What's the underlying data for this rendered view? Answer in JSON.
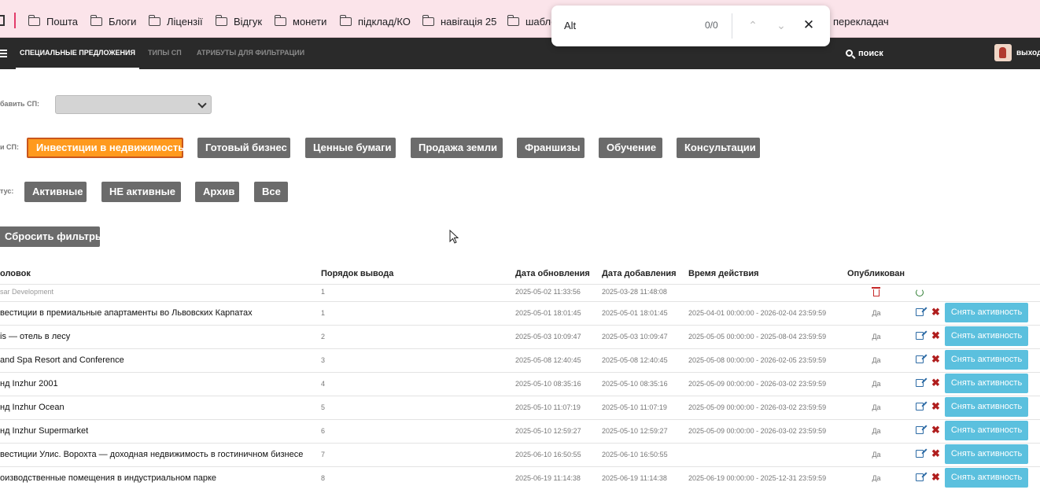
{
  "bookmarks": [
    "Пошта",
    "Блоги",
    "Ліцензії",
    "Відгук",
    "монети",
    "підклад/КО",
    "навігація 25",
    "шабло",
    "перекладач"
  ],
  "find": {
    "query": "Alt",
    "count": "0/0"
  },
  "nav": {
    "tabs": [
      "СПЕЦИАЛЬНЫЕ ПРЕДЛОЖЕНИЯ",
      "ТИПЫ СП",
      "АТРИБУТЫ ДЛЯ ФИЛЬТРАЦИИ"
    ],
    "search": "поиск",
    "exit": "выход"
  },
  "filters": {
    "add_label": "бавить СП:",
    "type_label": "и СП:",
    "status_label": "тус:",
    "types": [
      "Инвестиции в недвижимость",
      "Готовый бизнес",
      "Ценные бумаги",
      "Продажа земли",
      "Франшизы",
      "Обучение",
      "Консультации"
    ],
    "statuses": [
      "Активные",
      "НЕ активные",
      "Архив",
      "Все"
    ],
    "reset": "Сбросить фильтры"
  },
  "table": {
    "headers": [
      "оловок",
      "Порядок вывода",
      "Дата обновления",
      "Дата добавления",
      "Время действия",
      "Опубликован"
    ],
    "rows": [
      {
        "title": "sar Development",
        "order": "1",
        "updated": "2025-05-02 11:33:56",
        "added": "2025-03-28 11:48:08",
        "period": "",
        "published": "",
        "deleted": true
      },
      {
        "title": "вестиции в премиальные апартаменты во Львовских Карпатах",
        "order": "1",
        "updated": "2025-05-01 18:01:45",
        "added": "2025-05-01 18:01:45",
        "period": "2025-04-01 00:00:00 - 2026-02-04 23:59:59",
        "published": "Да",
        "action": "Снять активность"
      },
      {
        "title": "is — отель в лесу",
        "order": "2",
        "updated": "2025-05-03 10:09:47",
        "added": "2025-05-03 10:09:47",
        "period": "2025-05-05 00:00:00 - 2025-08-04 23:59:59",
        "published": "Да",
        "action": "Снять активность"
      },
      {
        "title": "and Spa Resort and Conference",
        "order": "3",
        "updated": "2025-05-08 12:40:45",
        "added": "2025-05-08 12:40:45",
        "period": "2025-05-08 00:00:00 - 2026-02-05 23:59:59",
        "published": "Да",
        "action": "Снять активность"
      },
      {
        "title": "нд Inzhur 2001",
        "order": "4",
        "updated": "2025-05-10 08:35:16",
        "added": "2025-05-10 08:35:16",
        "period": "2025-05-09 00:00:00 - 2026-03-02 23:59:59",
        "published": "Да",
        "action": "Снять активность"
      },
      {
        "title": "нд Inzhur Ocean",
        "order": "5",
        "updated": "2025-05-10 11:07:19",
        "added": "2025-05-10 11:07:19",
        "period": "2025-05-09 00:00:00 - 2026-03-02 23:59:59",
        "published": "Да",
        "action": "Снять активность"
      },
      {
        "title": "нд Inzhur Supermarket",
        "order": "6",
        "updated": "2025-05-10 12:59:27",
        "added": "2025-05-10 12:59:27",
        "period": "2025-05-09 00:00:00 - 2026-03-02 23:59:59",
        "published": "Да",
        "action": "Снять активность"
      },
      {
        "title": "вестиции Улис. Ворохта — доходная недвижимость в гостиничном бизнесе",
        "order": "7",
        "updated": "2025-06-10 16:50:55",
        "added": "2025-06-10 16:50:55",
        "period": "",
        "published": "Да",
        "action": "Снять активность"
      },
      {
        "title": "оизводственные помещения в индустриальном парке",
        "order": "8",
        "updated": "2025-06-19 11:14:38",
        "added": "2025-06-19 11:14:38",
        "period": "2025-06-19 00:00:00 - 2025-12-31 23:59:59",
        "published": "Да",
        "action": "Снять активность"
      }
    ]
  }
}
